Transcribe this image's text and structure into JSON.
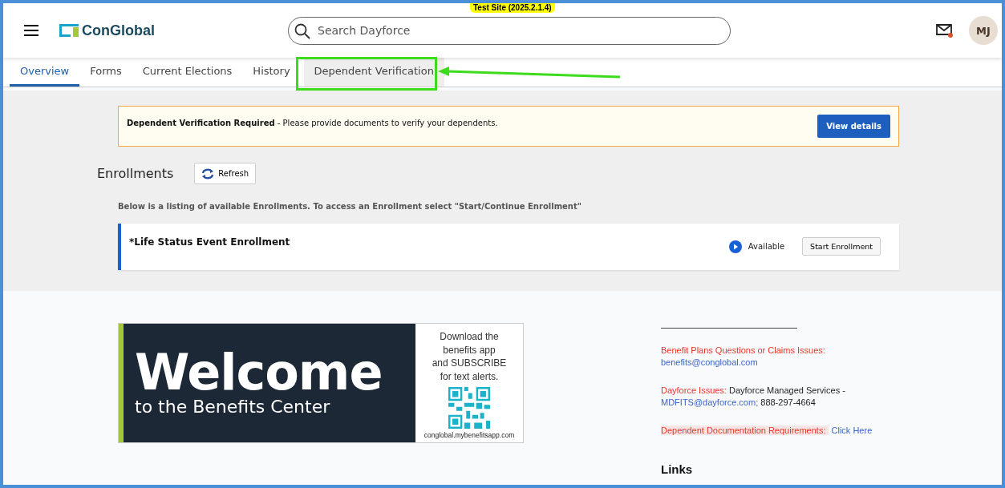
{
  "header": {
    "badge": "Test Site (2025.2.1.4)",
    "logo": "ConGlobal",
    "search": {
      "placeholder": "Search Dayforce"
    },
    "notifications_unread": true,
    "avatar": "MJ"
  },
  "tabs": [
    {
      "label": "Overview",
      "selected": true
    },
    {
      "label": "Forms",
      "selected": false
    },
    {
      "label": "Current Elections",
      "selected": false
    },
    {
      "label": "History",
      "selected": false
    },
    {
      "label": "Dependent Verification",
      "selected": false,
      "annotated": true
    }
  ],
  "alert": {
    "message": "**Dependent Verification Required** - Please provide documents to verify your dependents.",
    "button": "View details"
  },
  "enrollments": {
    "title": "Enrollments",
    "refresh": "Refresh",
    "description": "Below is a listing of available Enrollments. To access an Enrollment select \"Start/Continue Enrollment\"",
    "items": [
      {
        "name": "*Life Status Event Enrollment",
        "status": "Available",
        "button": "Start Enrollment"
      }
    ]
  },
  "banner": {
    "title": "Welcome",
    "subtitle": "to the Benefits Center",
    "promo": [
      "Download the",
      "benefits app",
      "and SUBSCRIBE",
      "for text alerts."
    ],
    "url": "conglobal.mybenefitsapp.com"
  },
  "contacts": [
    {
      "kind": "stacked",
      "label": "Benefit Plans Questions or Claims Issues:",
      "link": "benefits@conglobal.com",
      "highlight": false
    },
    {
      "kind": "stacked",
      "label": "Dayforce Issues:",
      "text": "Dayforce Managed Services -",
      "link": "MDFITS@dayforce.com;",
      "after": "888-297-4664",
      "highlight": false
    },
    {
      "kind": "inline",
      "label": "Dependent Documentation Requirements:",
      "link": "Click Here",
      "highlight": true
    }
  ],
  "links": {
    "title": "Links"
  }
}
